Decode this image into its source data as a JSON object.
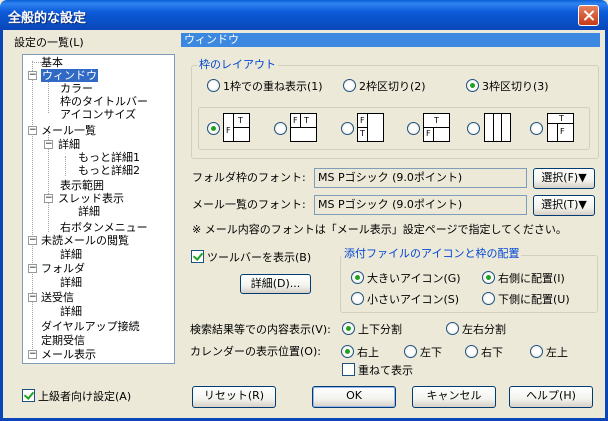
{
  "window": {
    "title": "全般的な設定"
  },
  "tree_panel": {
    "label": "設定の一覧(L)",
    "items": [
      {
        "label": "基本"
      },
      {
        "label": "ウィンドウ"
      },
      {
        "label": "カラー"
      },
      {
        "label": "枠のタイトルバー"
      },
      {
        "label": "アイコンサイズ"
      },
      {
        "label": "メール一覧"
      },
      {
        "label": "詳細"
      },
      {
        "label": "もっと詳細1"
      },
      {
        "label": "もっと詳細2"
      },
      {
        "label": "表示範囲"
      },
      {
        "label": "スレッド表示"
      },
      {
        "label": "詳細"
      },
      {
        "label": "右ボタンメニュー"
      },
      {
        "label": "未読メールの閲覧"
      },
      {
        "label": "詳細"
      },
      {
        "label": "フォルダ"
      },
      {
        "label": "詳細"
      },
      {
        "label": "送受信"
      },
      {
        "label": "詳細"
      },
      {
        "label": "ダイヤルアップ接続"
      },
      {
        "label": "定期受信"
      },
      {
        "label": "メール表示"
      }
    ],
    "advanced_checkbox": {
      "label": "上級者向け設定(A)",
      "checked": true
    }
  },
  "section_header": "ウィンドウ",
  "frame_layout": {
    "group_label": "枠のレイアウト",
    "options": [
      {
        "label": "1枠での重ね表示(1)",
        "selected": false
      },
      {
        "label": "2枠区切り(2)",
        "selected": false
      },
      {
        "label": "3枠区切り(3)",
        "selected": true
      }
    ],
    "layout_icons": [
      {
        "name": "layout-1",
        "selected": true
      },
      {
        "name": "layout-2",
        "selected": false
      },
      {
        "name": "layout-3",
        "selected": false
      },
      {
        "name": "layout-4",
        "selected": false
      },
      {
        "name": "layout-5",
        "selected": false
      },
      {
        "name": "layout-6",
        "selected": false
      }
    ]
  },
  "fonts": {
    "folder_label": "フォルダ枠のフォント:",
    "folder_value": "MS Pゴシック (9.0ポイント)",
    "folder_button": "選択(F)▼",
    "list_label": "メール一覧のフォント:",
    "list_value": "MS Pゴシック (9.0ポイント)",
    "list_button": "選択(T)▼",
    "note": "※ メール内容のフォントは「メール表示」設定ページで指定してください。"
  },
  "toolbar": {
    "show_label": "ツールバーを表示(B)",
    "show_checked": true,
    "detail_button": "詳細(D)..."
  },
  "attachment": {
    "group_label": "添付ファイルのアイコンと枠の配置",
    "large_icon": "大きいアイコン(G)",
    "large_selected": true,
    "small_icon": "小さいアイコン(S)",
    "small_selected": false,
    "right_place": "右側に配置(I)",
    "right_selected": true,
    "bottom_place": "下側に配置(U)",
    "bottom_selected": false
  },
  "search_display": {
    "label": "検索結果等での内容表示(V):",
    "options": [
      {
        "label": "上下分割",
        "selected": true
      },
      {
        "label": "左右分割",
        "selected": false
      }
    ]
  },
  "calendar": {
    "label": "カレンダーの表示位置(O):",
    "options": [
      {
        "label": "右上",
        "selected": true
      },
      {
        "label": "左下",
        "selected": false
      },
      {
        "label": "右下",
        "selected": false
      },
      {
        "label": "左上",
        "selected": false
      }
    ],
    "overlap_label": "重ねて表示",
    "overlap_checked": false
  },
  "buttons": {
    "reset": "リセット(R)",
    "ok": "OK",
    "cancel": "キャンセル",
    "help": "ヘルプ(H)"
  }
}
